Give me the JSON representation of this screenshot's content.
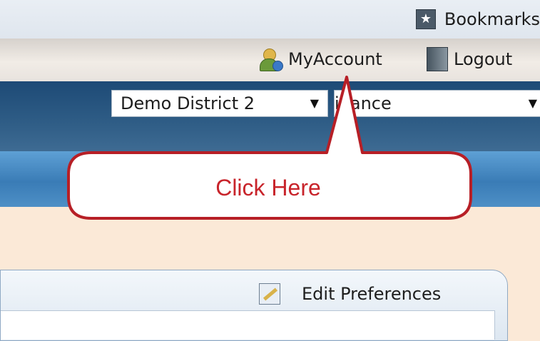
{
  "header": {
    "bookmarks_label": "Bookmarks",
    "bookmarks_icon": "star-bookmark-icon"
  },
  "account_bar": {
    "myaccount_label": "MyAccount",
    "myaccount_icon": "user-account-icon",
    "logout_label": "Logout",
    "logout_icon": "logout-door-icon"
  },
  "selectors": {
    "district_value": "Demo District 2",
    "module_value": "inance"
  },
  "callout": {
    "text": "Click Here",
    "color": "#c8242b"
  },
  "panel": {
    "edit_preferences_label": "Edit Preferences",
    "edit_preferences_icon": "edit-pencil-icon"
  },
  "colors": {
    "nav_dark": "#2f5d86",
    "nav_band": "#4d8fc6",
    "page_bg": "#fbe9d7"
  }
}
